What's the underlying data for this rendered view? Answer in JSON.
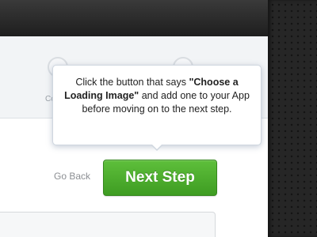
{
  "steps": {
    "items": [
      {
        "label": "Co"
      },
      {
        "label": ""
      }
    ]
  },
  "tooltip": {
    "text_before": "Click the button that says ",
    "emphasis": "\"Choose a Loading Image\"",
    "text_after": " and add one to your App before moving on to the next step."
  },
  "actions": {
    "go_back_label": "Go Back",
    "next_step_label": "Next Step"
  },
  "colors": {
    "primary_button": "#4caf30",
    "tooltip_border": "#cfd6df",
    "background_dark": "#262626"
  }
}
